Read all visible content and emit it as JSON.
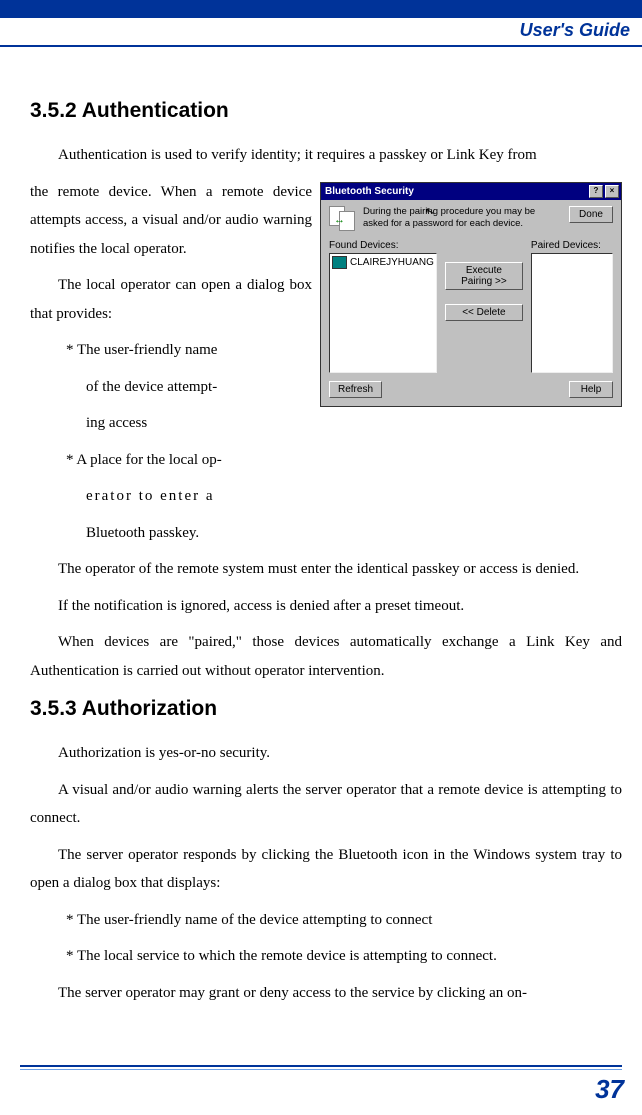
{
  "header": {
    "title": "User's Guide"
  },
  "sections": {
    "auth": {
      "heading": "3.5.2  Authentication",
      "p1a": "Authentication is used to verify identity; it requires a passkey or Link Key from",
      "p1b": "the remote device. When a remote device attempts access, a visual and/or audio warning notifies the local operator.",
      "p2": "The local operator can open a dialog box that provides:",
      "b1a": "* The user-friendly name",
      "b1b": "of the device attempt-",
      "b1c": "ing access",
      "b2a": "* A place for the local op-",
      "b2b": "erator to enter a",
      "b2c": "Bluetooth passkey.",
      "p3": "The operator of the remote system must enter the identical passkey or access is denied.",
      "p4": "If the notification is ignored, access is denied after a preset timeout.",
      "p5": "When devices are \"paired,\" those devices automatically exchange a Link Key and Authentication is carried out without operator intervention."
    },
    "authz": {
      "heading": "3.5.3  Authorization",
      "p1": "Authorization is yes-or-no security.",
      "p2": "A visual and/or audio warning alerts the server operator that a remote device is attempting to connect.",
      "p3": "The server operator responds by clicking the Bluetooth icon in the Windows system tray to open a dialog box that displays:",
      "b1": "* The user-friendly name of the device attempting to connect",
      "b2": "* The local service to which the remote device is attempting to connect.",
      "p4": "The server operator may grant or deny access to the service by clicking an on-"
    }
  },
  "dialog": {
    "title": "Bluetooth Security",
    "message": "During the pairing procedure you may be asked for a password for each device.",
    "done": "Done",
    "found_label": "Found Devices:",
    "paired_label": "Paired Devices:",
    "device": "CLAIREJYHUANG",
    "exec_pairing": "Execute Pairing >>",
    "delete": "<< Delete",
    "refresh": "Refresh",
    "help": "Help",
    "help_ctrl": "?",
    "close_ctrl": "×"
  },
  "page_number": "37"
}
